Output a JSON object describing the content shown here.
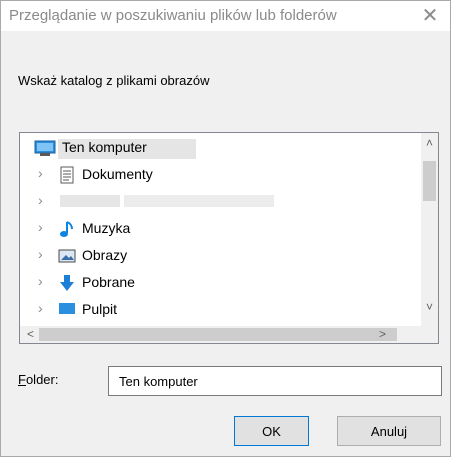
{
  "window": {
    "title": "Przeglądanie w poszukiwaniu plików lub folderów",
    "close_glyph": "✕"
  },
  "prompt": "Wskaż katalog z plikami obrazów",
  "tree": {
    "items": [
      {
        "label": "Ten komputer",
        "icon": "computer-icon",
        "selected": true
      },
      {
        "label": "Dokumenty",
        "icon": "documents-icon",
        "expand": "›"
      },
      {
        "label": "",
        "icon": "redacted-icon",
        "expand": "›"
      },
      {
        "label": "Muzyka",
        "icon": "music-icon",
        "expand": "›"
      },
      {
        "label": "Obrazy",
        "icon": "pictures-icon",
        "expand": "›"
      },
      {
        "label": "Pobrane",
        "icon": "downloads-icon",
        "expand": "›"
      },
      {
        "label": "Pulpit",
        "icon": "desktop-icon",
        "expand": "›"
      }
    ],
    "scroll_up": "˄",
    "scroll_down": "˅",
    "scroll_left": "<",
    "scroll_right": ">"
  },
  "folder": {
    "label_prefix": "F",
    "label_rest": "older:",
    "value": "Ten komputer"
  },
  "buttons": {
    "ok": "OK",
    "cancel": "Anuluj"
  },
  "colors": {
    "accent": "#0078d7",
    "music": "#0a84e0",
    "downloads": "#1e7fd6"
  }
}
